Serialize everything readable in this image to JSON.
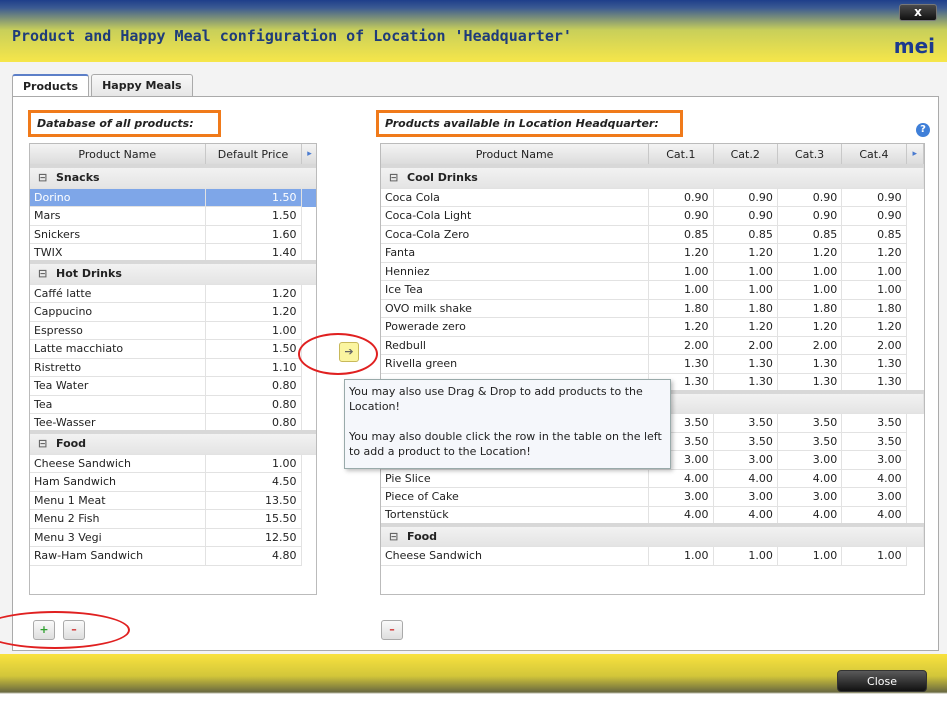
{
  "window": {
    "title": "Product and Happy Meal configuration of Location 'Headquarter'",
    "close_x": "x",
    "logo": "mei"
  },
  "tabs": [
    "Products",
    "Happy Meals"
  ],
  "left": {
    "label": "Database of all products:",
    "columns": [
      "Product Name",
      "Default Price"
    ],
    "groups": [
      {
        "name": "Snacks",
        "rows": [
          [
            "Dorino",
            "1.50"
          ],
          [
            "Mars",
            "1.50"
          ],
          [
            "Snickers",
            "1.60"
          ],
          [
            "TWIX",
            "1.40"
          ]
        ]
      },
      {
        "name": "Hot Drinks",
        "rows": [
          [
            "Caffé latte",
            "1.20"
          ],
          [
            "Cappucino",
            "1.20"
          ],
          [
            "Espresso",
            "1.00"
          ],
          [
            "Latte macchiato",
            "1.50"
          ],
          [
            "Ristretto",
            "1.10"
          ],
          [
            "Tea Water",
            "0.80"
          ],
          [
            "Tea",
            "0.80"
          ],
          [
            "Tee-Wasser",
            "0.80"
          ]
        ]
      },
      {
        "name": "Food",
        "rows": [
          [
            "Cheese Sandwich",
            "1.00"
          ],
          [
            "Ham Sandwich",
            "4.50"
          ],
          [
            "Menu 1 Meat",
            "13.50"
          ],
          [
            "Menu 2 Fish",
            "15.50"
          ],
          [
            "Menu 3 Vegi",
            "12.50"
          ],
          [
            "Raw-Ham Sandwich",
            "4.80"
          ]
        ]
      }
    ],
    "selected_row": "Dorino",
    "add_button": "+",
    "remove_button": "–"
  },
  "right": {
    "label": "Products available in Location Headquarter:",
    "columns": [
      "Product Name",
      "Cat.1",
      "Cat.2",
      "Cat.3",
      "Cat.4"
    ],
    "groups": [
      {
        "name": "Cool Drinks",
        "rows": [
          [
            "Coca Cola",
            "0.90",
            "0.90",
            "0.90",
            "0.90"
          ],
          [
            "Coca-Cola Light",
            "0.90",
            "0.90",
            "0.90",
            "0.90"
          ],
          [
            "Coca-Cola Zero",
            "0.85",
            "0.85",
            "0.85",
            "0.85"
          ],
          [
            "Fanta",
            "1.20",
            "1.20",
            "1.20",
            "1.20"
          ],
          [
            "Henniez",
            "1.00",
            "1.00",
            "1.00",
            "1.00"
          ],
          [
            "Ice Tea",
            "1.00",
            "1.00",
            "1.00",
            "1.00"
          ],
          [
            "OVO milk shake",
            "1.80",
            "1.80",
            "1.80",
            "1.80"
          ],
          [
            "Powerade zero",
            "1.20",
            "1.20",
            "1.20",
            "1.20"
          ],
          [
            "Redbull",
            "2.00",
            "2.00",
            "2.00",
            "2.00"
          ],
          [
            "Rivella green",
            "1.30",
            "1.30",
            "1.30",
            "1.30"
          ],
          [
            "",
            "1.30",
            "1.30",
            "1.30",
            "1.30"
          ]
        ]
      },
      {
        "name": "",
        "rows": [
          [
            "",
            "3.50",
            "3.50",
            "3.50",
            "3.50"
          ],
          [
            "",
            "3.50",
            "3.50",
            "3.50",
            "3.50"
          ],
          [
            "Kuchenstück",
            "3.00",
            "3.00",
            "3.00",
            "3.00"
          ],
          [
            "Pie Slice",
            "4.00",
            "4.00",
            "4.00",
            "4.00"
          ],
          [
            "Piece of Cake",
            "3.00",
            "3.00",
            "3.00",
            "3.00"
          ],
          [
            "Tortenstück",
            "4.00",
            "4.00",
            "4.00",
            "4.00"
          ]
        ]
      },
      {
        "name": "Food",
        "rows": [
          [
            "Cheese Sandwich",
            "1.00",
            "1.00",
            "1.00",
            "1.00"
          ]
        ]
      }
    ],
    "remove_button": "–",
    "help": "?"
  },
  "tooltip": {
    "line1": "You may also use Drag & Drop to add products to the Location!",
    "line2": "You may also double click the row in the table on the left to add a product to the Location!"
  },
  "footer": {
    "close_label": "Close"
  },
  "colors": {
    "accent_orange": "#f07a1a",
    "annotation_red": "#e02020",
    "selection_blue": "#7ea6e8"
  }
}
